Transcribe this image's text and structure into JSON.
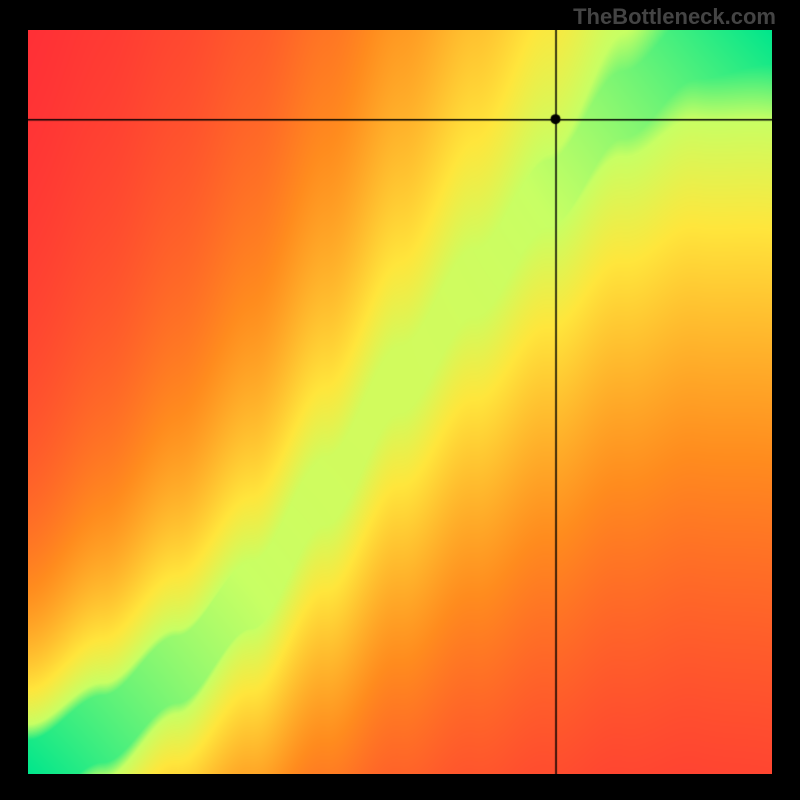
{
  "watermark": "TheBottleneck.com",
  "colors": {
    "background": "#000000",
    "crosshair": "#000000",
    "marker": "#000000",
    "watermark_text": "#444444"
  },
  "chart_data": {
    "type": "heatmap",
    "title": "",
    "xlabel": "",
    "ylabel": "",
    "x_range": [
      0,
      1
    ],
    "y_range": [
      0,
      1
    ],
    "xlim": [
      0,
      1
    ],
    "ylim": [
      0,
      1
    ],
    "color_scale": {
      "low": "#ff1a3c",
      "mid_low": "#ff8c1e",
      "mid": "#ffe63c",
      "mid_high": "#c8ff64",
      "high": "#00e68c"
    },
    "ideal_curve_control_points": [
      {
        "x": 0.0,
        "y": 0.0
      },
      {
        "x": 0.1,
        "y": 0.06
      },
      {
        "x": 0.2,
        "y": 0.14
      },
      {
        "x": 0.3,
        "y": 0.24
      },
      {
        "x": 0.4,
        "y": 0.38
      },
      {
        "x": 0.5,
        "y": 0.53
      },
      {
        "x": 0.6,
        "y": 0.66
      },
      {
        "x": 0.7,
        "y": 0.78
      },
      {
        "x": 0.8,
        "y": 0.9
      },
      {
        "x": 0.9,
        "y": 0.98
      },
      {
        "x": 1.0,
        "y": 1.0
      }
    ],
    "band_halfwidth": 0.045,
    "crosshair": {
      "x": 0.71,
      "y": 0.88
    },
    "marker": {
      "x": 0.71,
      "y": 0.88,
      "radius_px": 5
    },
    "grid": false,
    "legend": null
  }
}
